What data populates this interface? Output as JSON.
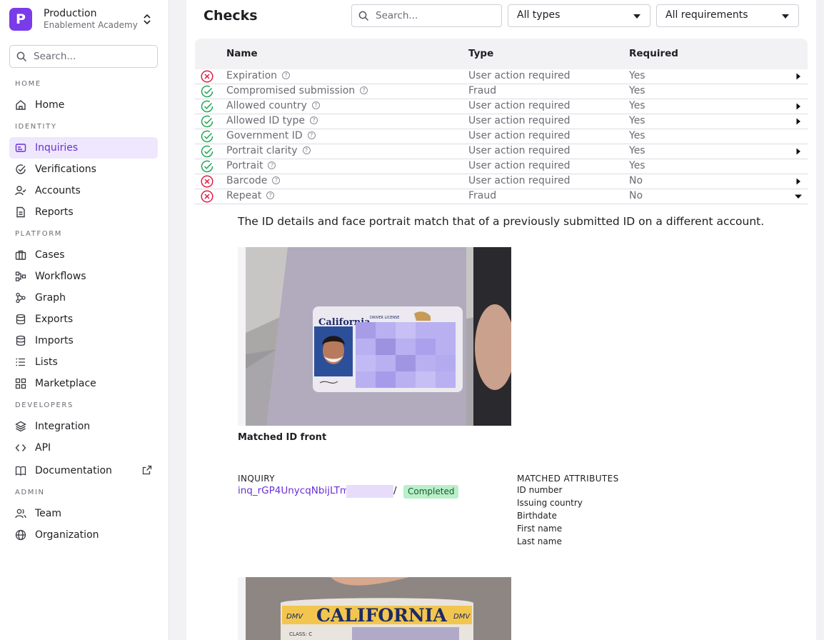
{
  "sidebar": {
    "org_initial": "P",
    "org_name": "Production",
    "org_sub": "Enablement Academy",
    "search_placeholder": "Search...",
    "sections": {
      "home": "HOME",
      "identity": "IDENTITY",
      "platform": "PLATFORM",
      "developers": "DEVELOPERS",
      "admin": "ADMIN"
    },
    "items": [
      {
        "label": "Home",
        "icon": "home-icon"
      },
      {
        "label": "Inquiries",
        "icon": "id-card-icon",
        "active": true
      },
      {
        "label": "Verifications",
        "icon": "check-circle-icon"
      },
      {
        "label": "Accounts",
        "icon": "user-check-icon"
      },
      {
        "label": "Reports",
        "icon": "report-icon"
      },
      {
        "label": "Cases",
        "icon": "briefcase-icon"
      },
      {
        "label": "Workflows",
        "icon": "workflow-icon"
      },
      {
        "label": "Graph",
        "icon": "graph-icon"
      },
      {
        "label": "Exports",
        "icon": "database-icon"
      },
      {
        "label": "Imports",
        "icon": "database-icon"
      },
      {
        "label": "Lists",
        "icon": "list-icon"
      },
      {
        "label": "Marketplace",
        "icon": "grid-icon"
      },
      {
        "label": "Integration",
        "icon": "layers-icon"
      },
      {
        "label": "API",
        "icon": "code-icon"
      },
      {
        "label": "Documentation",
        "icon": "book-icon",
        "external": true
      },
      {
        "label": "Team",
        "icon": "users-icon"
      },
      {
        "label": "Organization",
        "icon": "globe-icon"
      }
    ],
    "accent_color": "#7a3ce8"
  },
  "checks": {
    "title": "Checks",
    "search_placeholder": "Search...",
    "type_filter": "All types",
    "requirement_filter": "All requirements",
    "columns": {
      "name": "Name",
      "type": "Type",
      "required": "Required"
    },
    "rows": [
      {
        "name": "Expiration",
        "type": "User action required",
        "required": "Yes",
        "status": "failed",
        "expander": "collapsed"
      },
      {
        "name": "Compromised submission",
        "type": "Fraud",
        "required": "Yes",
        "status": "passed",
        "expander": "none"
      },
      {
        "name": "Allowed country",
        "type": "User action required",
        "required": "Yes",
        "status": "passed",
        "expander": "collapsed"
      },
      {
        "name": "Allowed ID type",
        "type": "User action required",
        "required": "Yes",
        "status": "passed",
        "expander": "collapsed"
      },
      {
        "name": "Government ID",
        "type": "User action required",
        "required": "Yes",
        "status": "passed",
        "expander": "none"
      },
      {
        "name": "Portrait clarity",
        "type": "User action required",
        "required": "Yes",
        "status": "passed",
        "expander": "collapsed"
      },
      {
        "name": "Portrait",
        "type": "User action required",
        "required": "Yes",
        "status": "passed",
        "expander": "none"
      },
      {
        "name": "Barcode",
        "type": "User action required",
        "required": "No",
        "status": "failed",
        "expander": "collapsed"
      },
      {
        "name": "Repeat",
        "type": "Fraud",
        "required": "No",
        "status": "failed",
        "expander": "expanded"
      }
    ]
  },
  "detail": {
    "description": "The ID details and face portrait match that of a previously submitted ID on a different account.",
    "photo1_caption": "Matched ID front",
    "photo_card_text": "California",
    "photo_card_sub": "DRIVER LICENSE",
    "photo2_text": "CALIFORNIA",
    "photo2_dmv": "DMV",
    "photo2_class": "CLASS: C",
    "inquiry_label": "INQUIRY",
    "inquiry_id": "inq_rGP4UnycqNbijLTm",
    "inquiry_sep": "/",
    "inquiry_status": "Completed",
    "matched_label": "MATCHED ATTRIBUTES",
    "matched_attributes": [
      "ID number",
      "Issuing country",
      "Birthdate",
      "First name",
      "Last name"
    ]
  }
}
